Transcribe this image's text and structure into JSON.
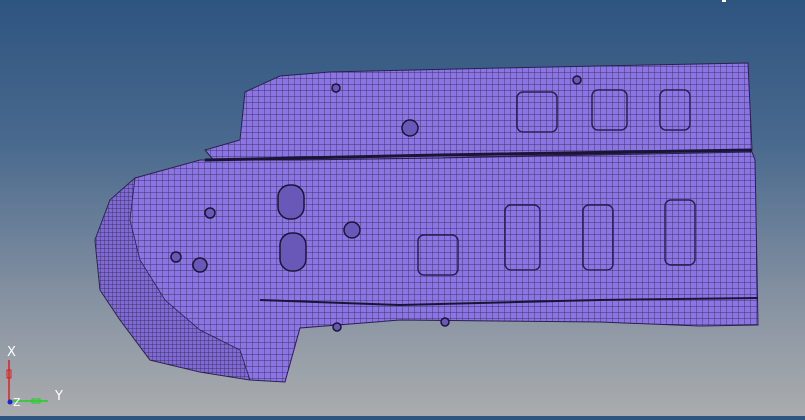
{
  "viewport": {
    "model": "shell-mesh-part",
    "mesh_color": "#8b74e4",
    "edge_color": "#2a2050",
    "background_top": "#2e5480",
    "background_bottom": "#aaacae"
  },
  "triad": {
    "x_label": "X",
    "y_label": "Y",
    "z_label": "Z",
    "x_color": "#e02020",
    "y_color": "#20d020",
    "z_color": "#2020e0"
  }
}
